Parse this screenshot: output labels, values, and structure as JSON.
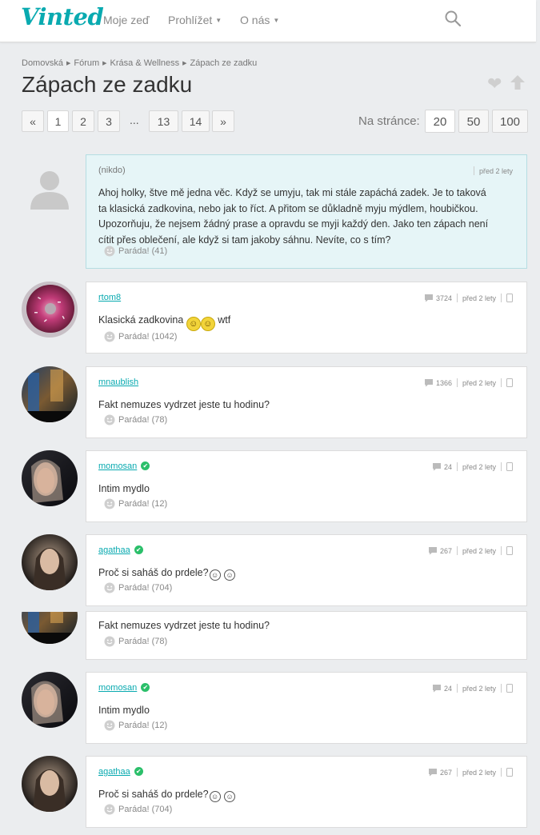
{
  "header": {
    "logo": "Vinted",
    "nav": [
      {
        "label": "Moje zeď"
      },
      {
        "label": "Prohlížet",
        "dropdown": true
      },
      {
        "label": "O nás",
        "dropdown": true
      }
    ],
    "search_icon": "search-icon"
  },
  "breadcrumb": [
    "Domovská",
    "Fórum",
    "Krása & Wellness",
    "Zápach ze zadku"
  ],
  "thread_title": "Zápach ze zadku",
  "actions": {
    "like_icon": "heart-icon",
    "up_icon": "arrow-up-icon"
  },
  "pagination": {
    "prev": "«",
    "pages": [
      "1",
      "2",
      "3"
    ],
    "ellipsis": "...",
    "last_pages": [
      "13",
      "14"
    ],
    "next": "»",
    "current": "1"
  },
  "per_page": {
    "label": "Na stránce:",
    "options": [
      "20",
      "50",
      "100"
    ],
    "selected": "20"
  },
  "colors": {
    "brand": "#09aab0",
    "verified": "#2bbf6a",
    "op_background": "#e6f5f7",
    "page_background": "#ebedef"
  },
  "posts": [
    {
      "user": "(nikdo)",
      "time": "před 2 lety",
      "lines": [
        "Ahoj holky, štve mě jedna věc. Když se umyju, tak mi stále zapáchá zadek. Je to taková",
        "ta klasická zadkovina, nebo jak to říct. A přitom se důkladně myju mýdlem, houbičkou.",
        "Upozorňuju, že nejsem žádný prase a opravdu se myji každý den. Jako ten zápach není",
        "cítit přes oblečení, ale když si tam jakoby sáhnu. Nevíte, co s tím?"
      ],
      "reactions": "Paráda! (41)"
    },
    {
      "user": "rtom8",
      "posts": "3724",
      "time": "před 2 lety",
      "text": "Klasická zadkovina",
      "suffix": "wtf",
      "reactions": "Paráda! (1042)"
    },
    {
      "user": "mnaublish",
      "posts": "1366",
      "time": "před 2 lety",
      "text": "Fakt nemuzes vydrzet jeste tu hodinu?",
      "reactions": "Paráda! (78)"
    },
    {
      "user": "momosan",
      "posts": "24",
      "time": "před 2 lety",
      "text": "Intim mydlo",
      "reactions": "Paráda! (12)"
    },
    {
      "user": "agathaa",
      "posts": "267",
      "time": "před 2 lety",
      "text": "Proč si saháš do prdele?",
      "reactions": "Paráda! (704)"
    },
    {
      "text": "Fakt nemuzes vydrzet jeste tu hodinu?",
      "reactions": "Paráda! (78)"
    },
    {
      "user": "momosan",
      "posts": "24",
      "time": "před 2 lety",
      "text": "Intim mydlo",
      "reactions": "Paráda! (12)"
    },
    {
      "user": "agathaa",
      "posts": "267",
      "time": "před 2 lety",
      "text": "Proč si saháš do prdele?",
      "reactions": "Paráda! (704)"
    }
  ]
}
